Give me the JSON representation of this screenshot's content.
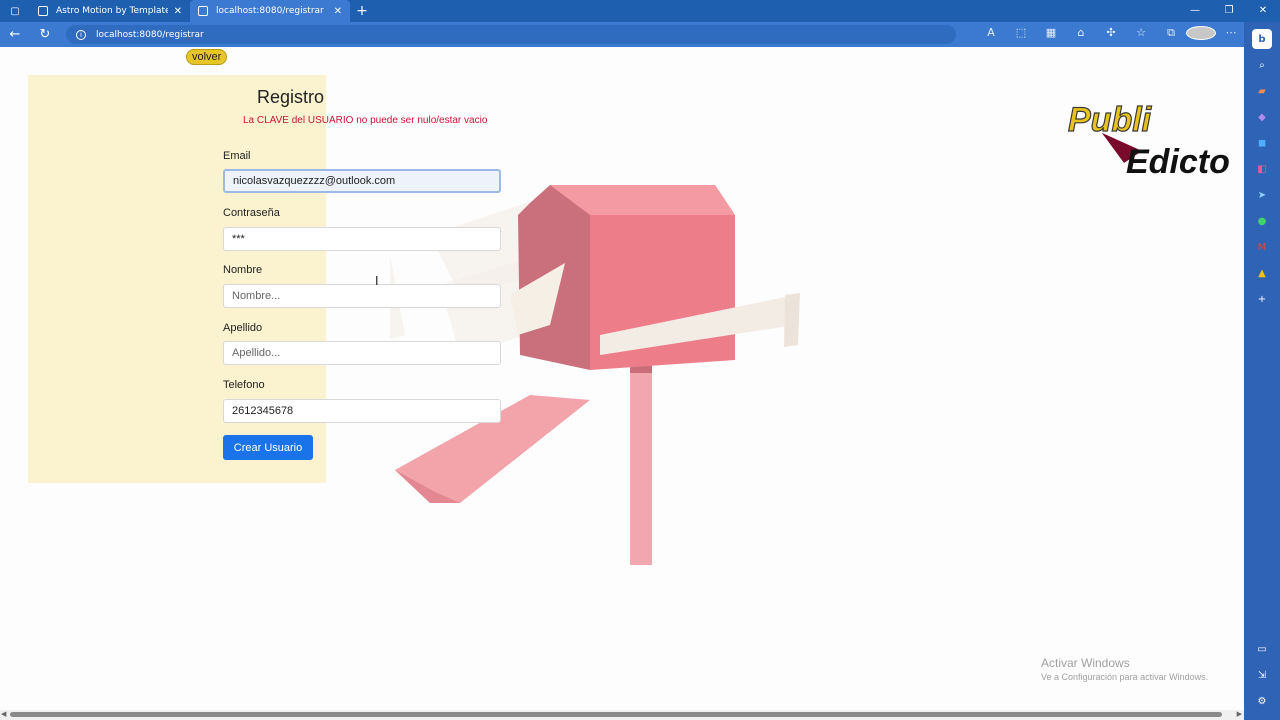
{
  "browser": {
    "tabs": [
      {
        "label": "Astro Motion by TemplateMo",
        "active": false
      },
      {
        "label": "localhost:8080/registrar",
        "active": true
      }
    ],
    "url": "localhost:8080/registrar"
  },
  "page": {
    "back_label": "volver",
    "title": "Registro",
    "error": "La CLAVE del USUARIO no puede ser nulo/estar vacio",
    "fields": {
      "email": {
        "label": "Email",
        "value": "nicolasvazquezzzz@outlook.com"
      },
      "password": {
        "label": "Contraseña",
        "value": "***"
      },
      "nombre": {
        "label": "Nombre",
        "placeholder": "Nombre..."
      },
      "apellido": {
        "label": "Apellido",
        "placeholder": "Apellido..."
      },
      "telefono": {
        "label": "Telefono",
        "value": "2612345678"
      }
    },
    "submit_label": "Crear Usuario",
    "logo_text": {
      "line1": "Publi",
      "line2": "Edicto"
    }
  },
  "os": {
    "watermark_title": "Activar Windows",
    "watermark_sub": "Ve a Configuración para activar Windows."
  },
  "colors": {
    "chrome_blue": "#1f5fb0",
    "panel": "#fbf3cf",
    "button": "#1a73e8",
    "error": "#d0103a",
    "mailbox": "#ec7f8a"
  }
}
